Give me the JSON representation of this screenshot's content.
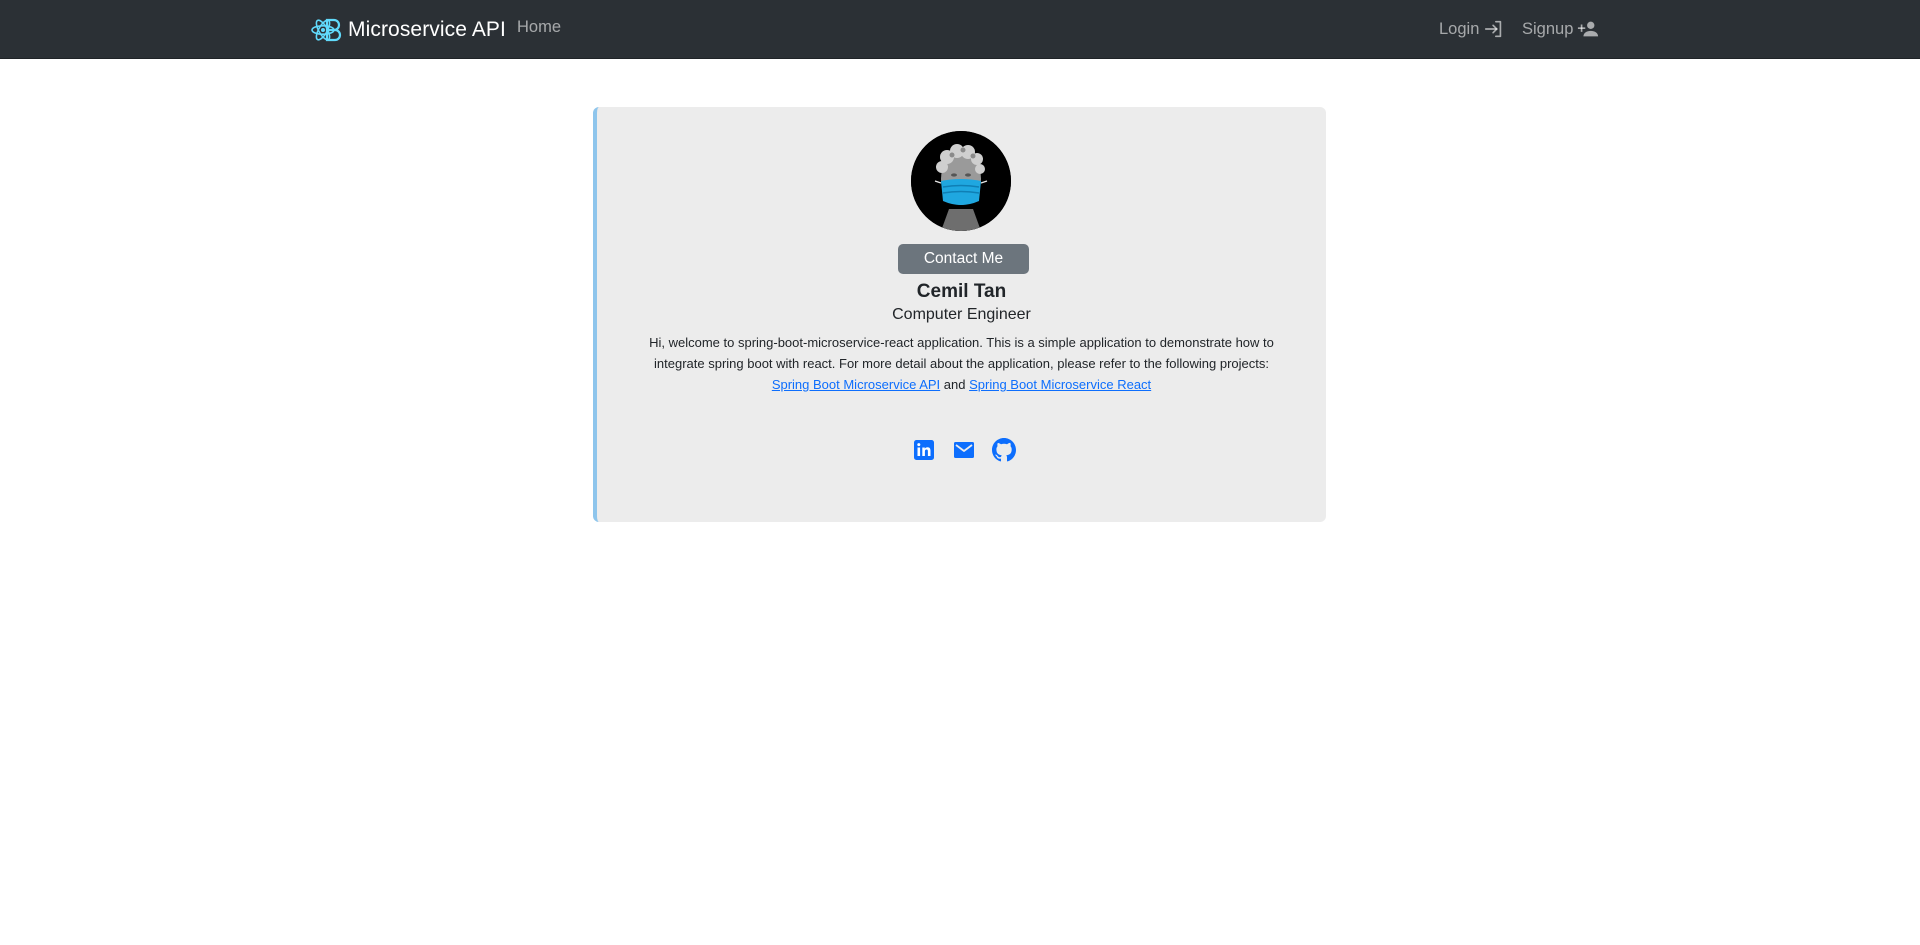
{
  "navbar": {
    "brand": "Microservice API",
    "home_label": "Home",
    "login_label": "Login",
    "signup_label": "Signup",
    "logo_icon": "react-logo-icon",
    "login_icon": "login-arrow-icon",
    "signup_icon": "person-add-icon"
  },
  "profile": {
    "contact_label": "Contact Me",
    "name": "Cemil Tan",
    "role": "Computer Engineer",
    "bio_intro": "Hi, welcome to spring-boot-microservice-react application. This is a simple application to demonstrate how to integrate spring boot with react. For more detail about the application, please refer to the following projects: ",
    "link_api_label": "Spring Boot Microservice API",
    "bio_and": " and ",
    "link_react_label": "Spring Boot Microservice React",
    "social_icons": [
      "linkedin-icon",
      "mail-icon",
      "github-icon"
    ]
  },
  "colors": {
    "navbar_bg": "#2b3035",
    "card_bg": "#ececec",
    "card_accent": "#8ec5ec",
    "link": "#0d6efd",
    "button_bg": "#6c757d",
    "logo": "#61dafb"
  }
}
